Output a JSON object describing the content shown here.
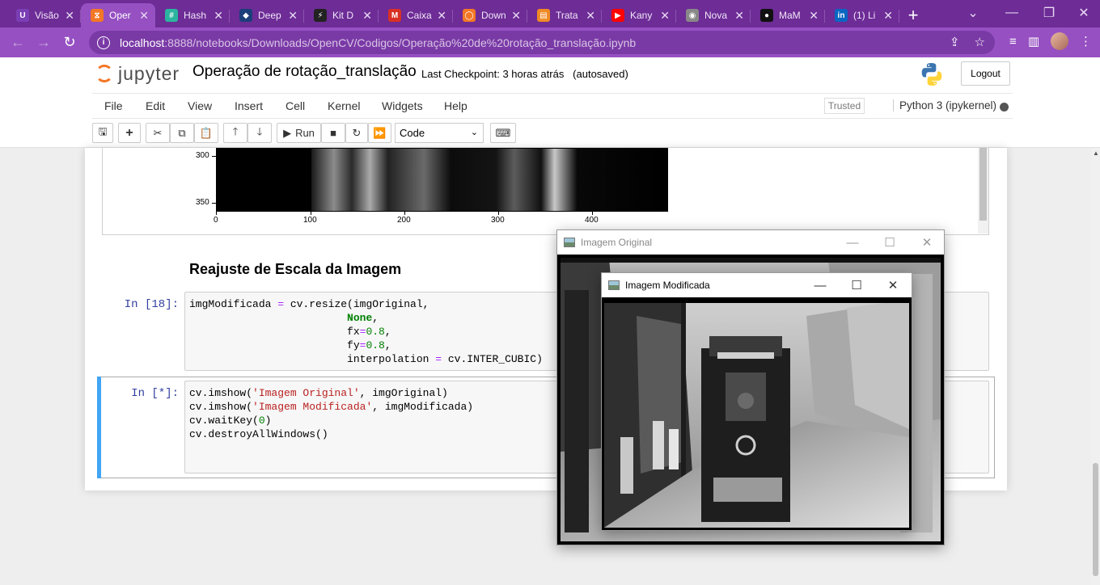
{
  "browser": {
    "tabs": [
      {
        "label": "Visão",
        "color": "#7b3fb5",
        "glyph": "U"
      },
      {
        "label": "Oper",
        "color": "#f37726",
        "glyph": "⧖",
        "active": true
      },
      {
        "label": "Hash",
        "color": "#2bb5a0",
        "glyph": "#"
      },
      {
        "label": "Deep",
        "color": "#1c3e7a",
        "glyph": "◆"
      },
      {
        "label": "Kit D",
        "color": "#222222",
        "glyph": "⚡"
      },
      {
        "label": "Caixa",
        "color": "#d93025",
        "glyph": "M"
      },
      {
        "label": "Down",
        "color": "#f37726",
        "glyph": "◯"
      },
      {
        "label": "Trata",
        "color": "#f08a24",
        "glyph": "▤"
      },
      {
        "label": "Kany",
        "color": "#ff0000",
        "glyph": "▶"
      },
      {
        "label": "Nova",
        "color": "#888888",
        "glyph": "◉"
      },
      {
        "label": "MaM",
        "color": "#111111",
        "glyph": "●"
      },
      {
        "label": "(1) Li",
        "color": "#0a66c2",
        "glyph": "in"
      }
    ],
    "url_host": "localhost",
    "url_path": ":8888/notebooks/Downloads/OpenCV/Codigos/Operação%20de%20rotação_translação.ipynb"
  },
  "jupyter": {
    "logo_text": "jupyter",
    "notebook_title": "Operação de rotação_translação",
    "checkpoint": "Last Checkpoint: 3 horas atrás",
    "autosaved": "(autosaved)",
    "logout": "Logout",
    "menu": [
      "File",
      "Edit",
      "View",
      "Insert",
      "Cell",
      "Kernel",
      "Widgets",
      "Help"
    ],
    "trusted": "Trusted",
    "kernel": "Python 3 (ipykernel)",
    "toolbar": {
      "run_label": "Run",
      "cell_type": "Code"
    }
  },
  "plot": {
    "yticks": [
      "300",
      "350"
    ],
    "xticks": [
      "0",
      "100",
      "200",
      "300",
      "400"
    ]
  },
  "cells": {
    "heading": "Reajuste de Escala da Imagem",
    "cell1_prompt": "In [18]:",
    "cell2_prompt": "In [*]:"
  },
  "windows": {
    "original_title": "Imagem Original",
    "modified_title": "Imagem Modificada"
  }
}
